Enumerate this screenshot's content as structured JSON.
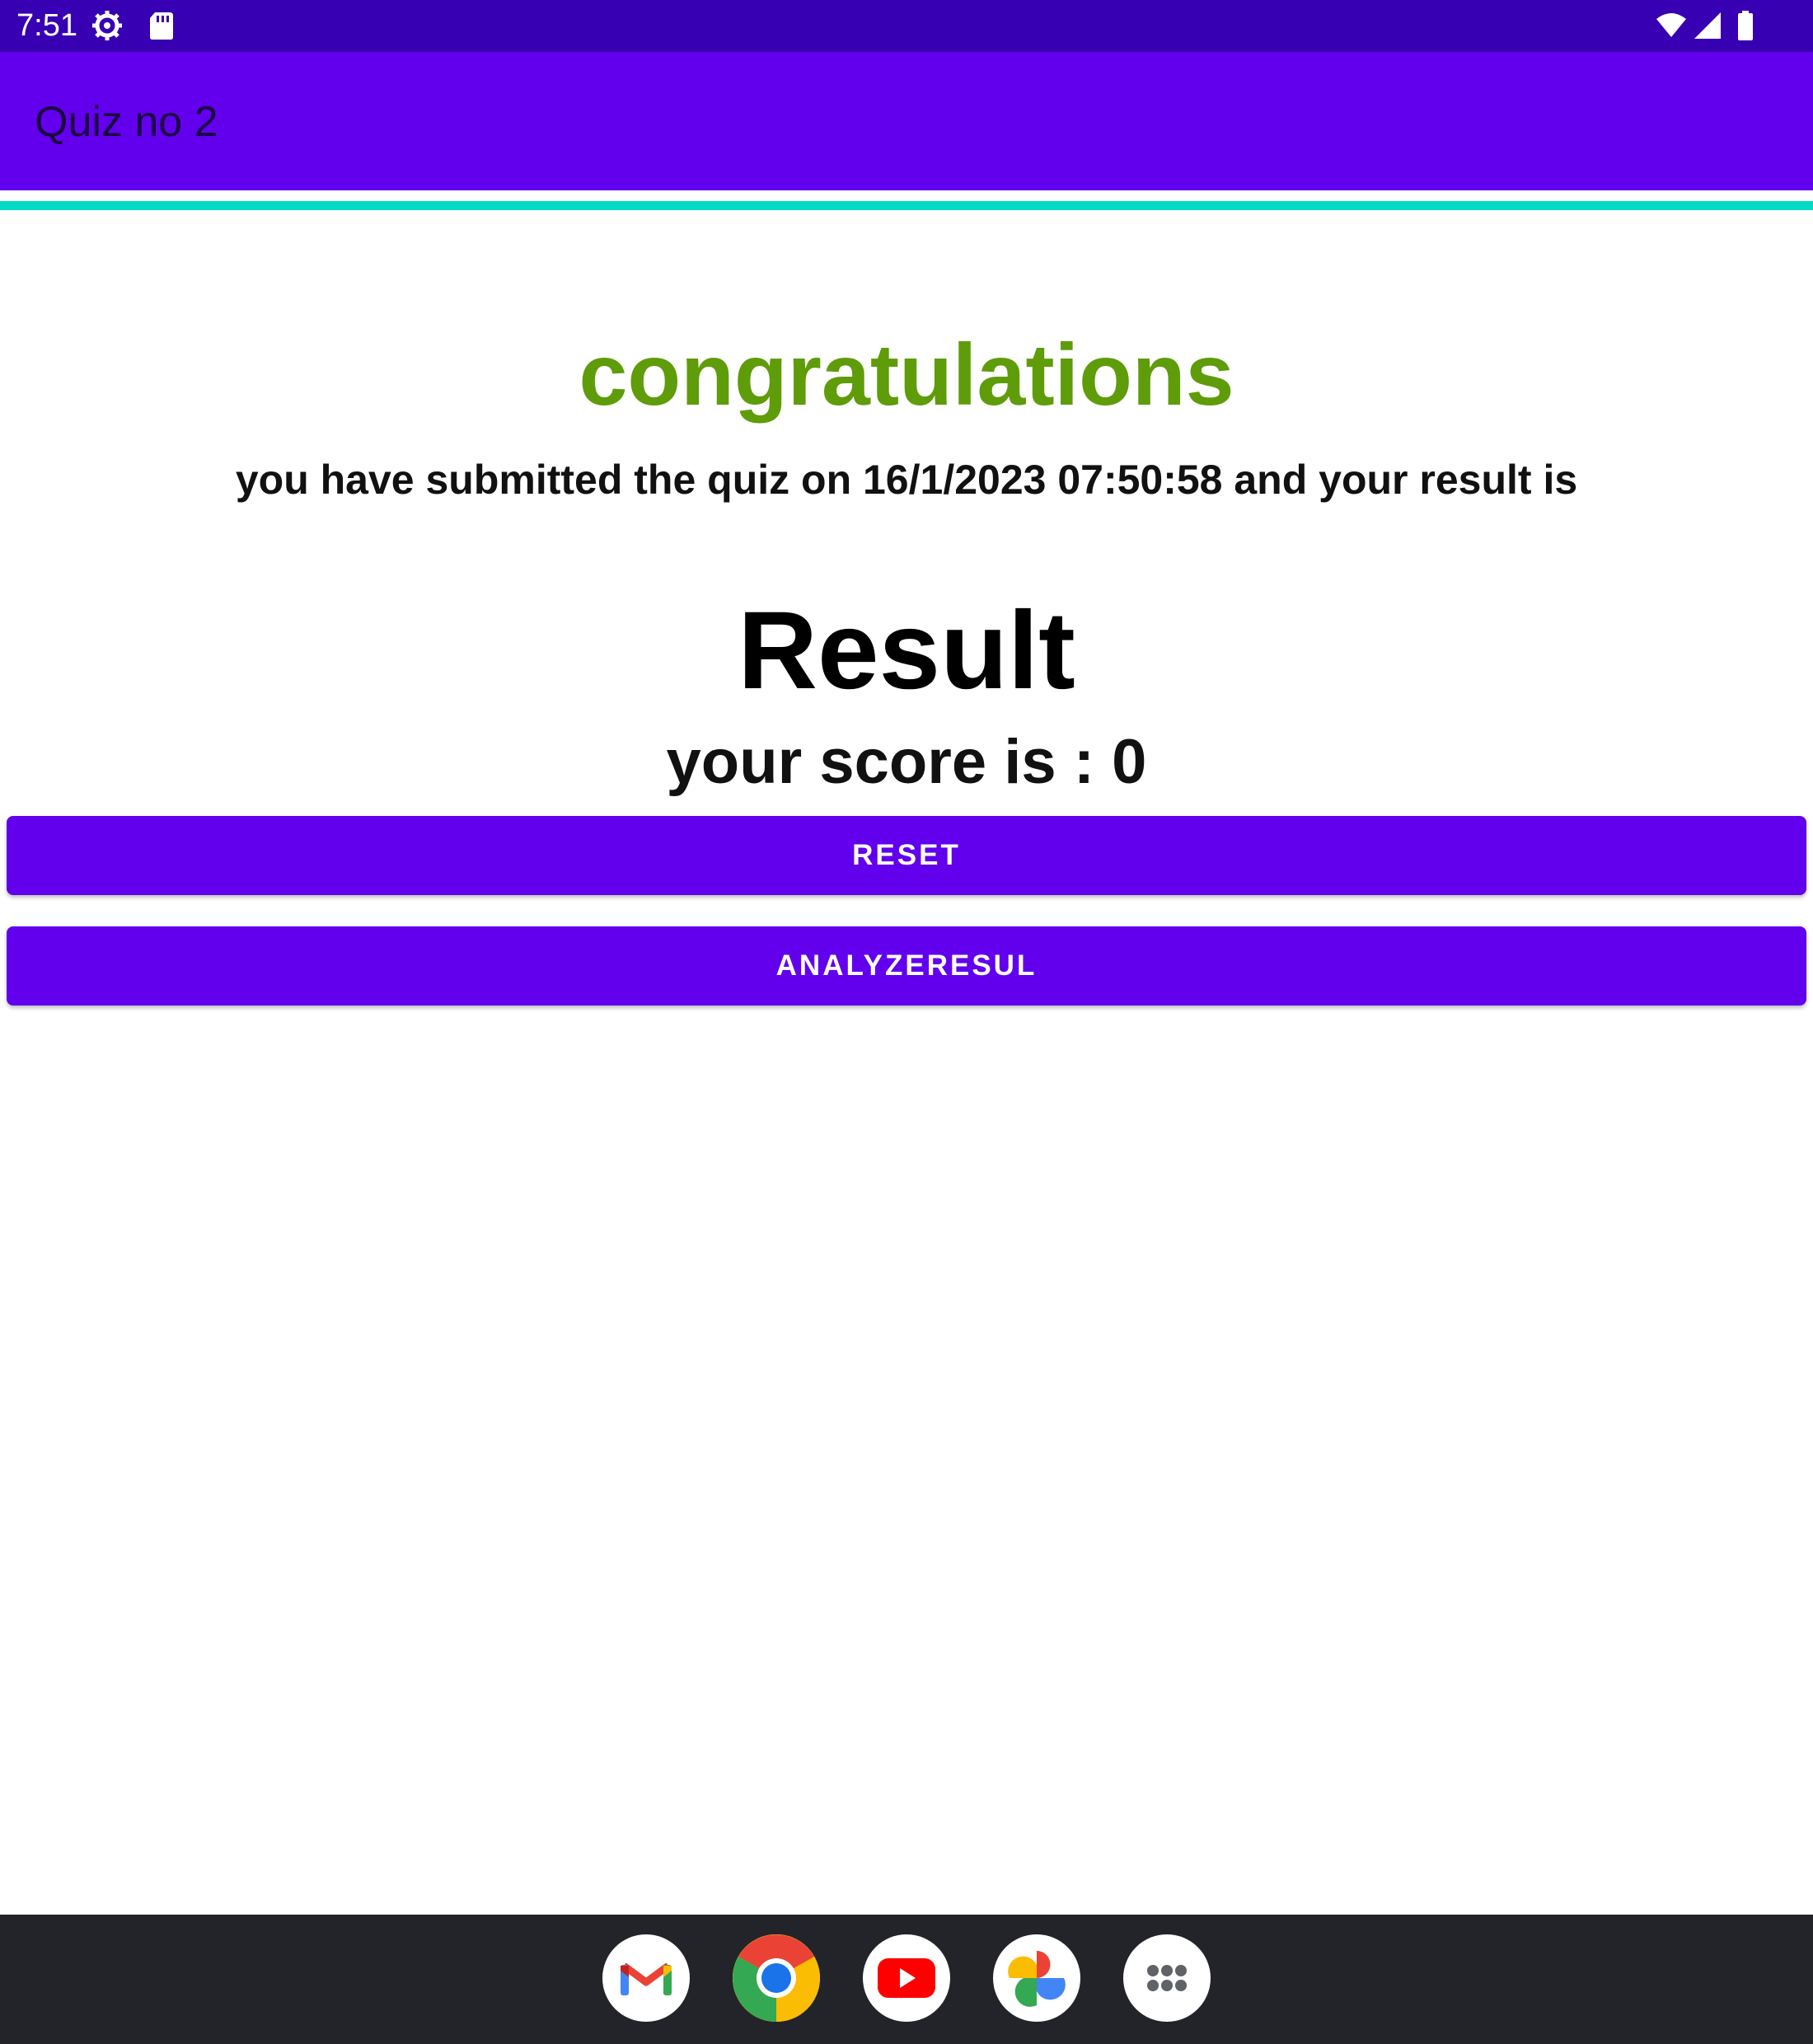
{
  "status_bar": {
    "time": "7:51",
    "icons": [
      "settings-gear-icon",
      "sd-card-icon",
      "wifi-icon",
      "cell-signal-icon",
      "battery-icon"
    ]
  },
  "app_bar": {
    "title": "Quiz no 2"
  },
  "result_screen": {
    "congrats": "congratulations",
    "submitted_message": "you have submitted the quiz on 16/1/2023 07:50:58 and your result is",
    "result_heading": "Result",
    "score_text": "your score is : 0"
  },
  "buttons": {
    "reset_label": "RESET",
    "analyze_label": "ANALYZERESUL"
  },
  "dock": {
    "apps": [
      "gmail-icon",
      "chrome-icon",
      "youtube-icon",
      "photos-icon",
      "app-drawer-icon"
    ]
  },
  "colors": {
    "status_bar": "#3700b3",
    "primary": "#6200ee",
    "accent_line": "#03dac5",
    "congrats_green": "#5f9c09",
    "nav_bar": "#232429"
  }
}
